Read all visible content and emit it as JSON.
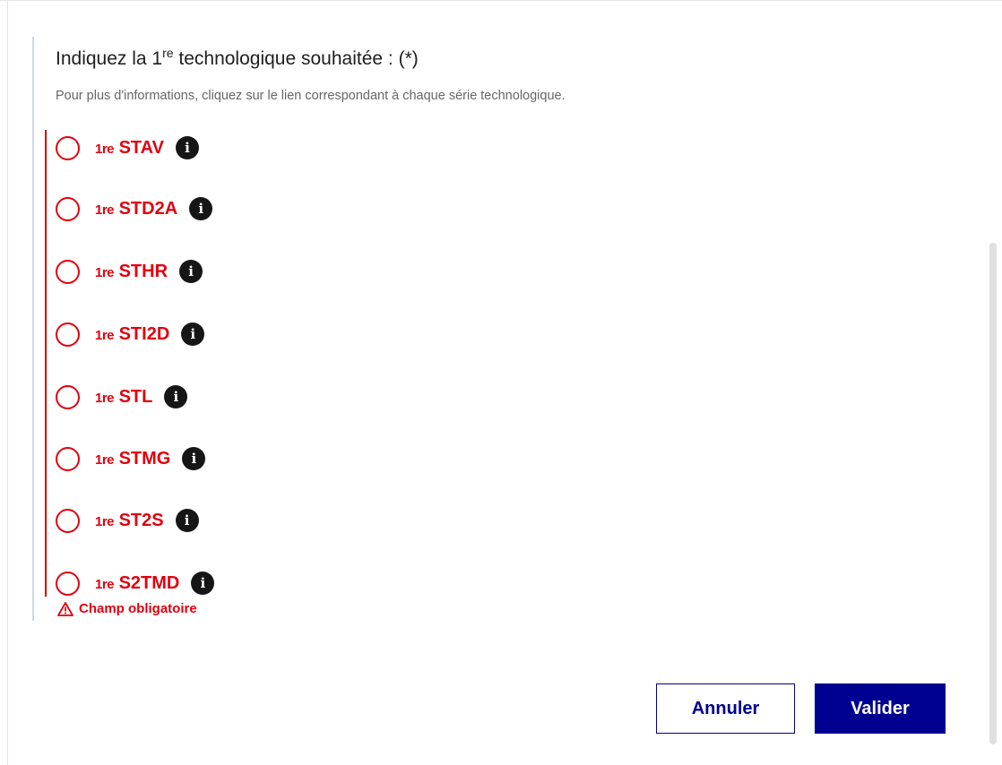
{
  "question": {
    "legend_before": "Indiquez la 1",
    "legend_sup": "re",
    "legend_after": " technologique souhaitée : (*)",
    "hint": "Pour plus d'informations, cliquez sur le lien correspondant à chaque série technologique."
  },
  "options": [
    {
      "prefix": "1re",
      "name": "STAV"
    },
    {
      "prefix": "1re",
      "name": "STD2A"
    },
    {
      "prefix": "1re",
      "name": "STHR"
    },
    {
      "prefix": "1re",
      "name": "STI2D"
    },
    {
      "prefix": "1re",
      "name": "STL"
    },
    {
      "prefix": "1re",
      "name": "STMG"
    },
    {
      "prefix": "1re",
      "name": "ST2S"
    },
    {
      "prefix": "1re",
      "name": "S2TMD"
    }
  ],
  "info_glyph": "i",
  "error": {
    "message": "Champ obligatoire"
  },
  "buttons": {
    "cancel": "Annuler",
    "validate": "Valider"
  },
  "colors": {
    "error": "#e1000f",
    "primary": "#000091",
    "info_icon": "#161616"
  },
  "icons": {
    "info": "info-circle-icon",
    "warning": "warning-triangle-icon"
  }
}
